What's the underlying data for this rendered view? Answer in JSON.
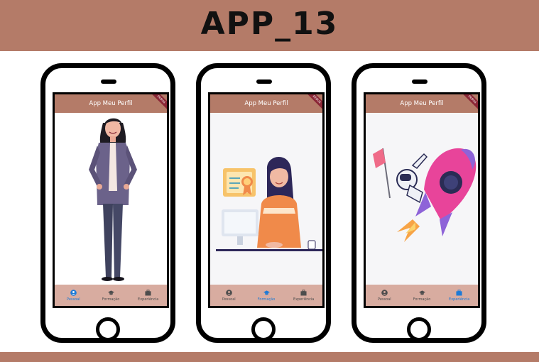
{
  "page": {
    "title": "APP_13"
  },
  "app": {
    "appbar_title": "App Meu Perfil",
    "debug_banner": "DEBUG"
  },
  "nav": {
    "items": [
      {
        "label": "Pessoal",
        "icon": "person-circle-icon"
      },
      {
        "label": "Formação",
        "icon": "graduation-cap-icon"
      },
      {
        "label": "Experiência",
        "icon": "briefcase-icon"
      }
    ]
  },
  "phones": [
    {
      "active_tab": "Pessoal",
      "illustration": "standing-woman-illustration"
    },
    {
      "active_tab": "Formação",
      "illustration": "woman-at-computer-with-certificate-illustration"
    },
    {
      "active_tab": "Experiência",
      "illustration": "astronaut-rocket-illustration"
    }
  ],
  "colors": {
    "banner": "#b47b68",
    "appbar": "#b47b68",
    "navbar": "#d8aca0",
    "active": "#1d7ad6",
    "inactive": "#4d4d4d"
  }
}
